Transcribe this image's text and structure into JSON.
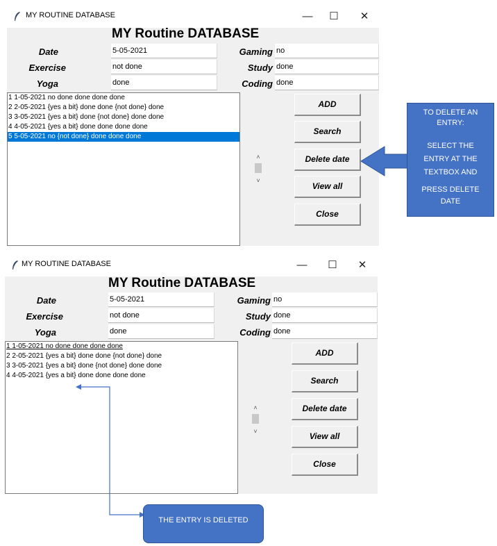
{
  "window": {
    "title": "MY ROUTINE DATABASE",
    "heading": "MY Routine DATABASE",
    "minimize": "—",
    "maximize": "☐",
    "close": "✕"
  },
  "fields": {
    "date_label": "Date",
    "exercise_label": "Exercise",
    "yoga_label": "Yoga",
    "gaming_label": "Gaming",
    "study_label": "Study",
    "coding_label": "Coding"
  },
  "before": {
    "date": "5-05-2021",
    "exercise": "not done",
    "yoga": "done",
    "gaming": "no",
    "study": "done",
    "coding": "done",
    "list": [
      "1 1-05-2021 no done done done done",
      "2 2-05-2021 {yes a bit} done done {not done} done",
      "3 3-05-2021 {yes a bit} done {not done} done done",
      "4 4-05-2021 {yes a bit} done done done done",
      "5 5-05-2021 no {not done} done done done"
    ],
    "selected_index": 4
  },
  "after": {
    "date": "5-05-2021",
    "exercise": "not done",
    "yoga": "done",
    "gaming": "no",
    "study": "done",
    "coding": "done",
    "list": [
      "1 1-05-2021 no done done done done",
      "2 2-05-2021 {yes a bit} done done {not done} done",
      "3 3-05-2021 {yes a bit} done {not done} done done",
      "4 4-05-2021 {yes a bit} done done done done"
    ]
  },
  "buttons": {
    "add": "ADD",
    "search": "Search",
    "delete": "Delete date",
    "view_all": "View all",
    "close": "Close"
  },
  "scrollbar": {
    "up": "˄",
    "down": "˅"
  },
  "callouts": {
    "delete_instructions": [
      "TO DELETE AN",
      "ENTRY:",
      "",
      "SELECT THE",
      "ENTRY AT THE",
      "TEXTBOX AND",
      "",
      "PRESS DELETE",
      "DATE"
    ],
    "deleted": "THE ENTRY IS DELETED"
  },
  "colors": {
    "callout_fill": "#4472c4",
    "selection": "#0078d7",
    "window_bg": "#f0f0f0"
  }
}
